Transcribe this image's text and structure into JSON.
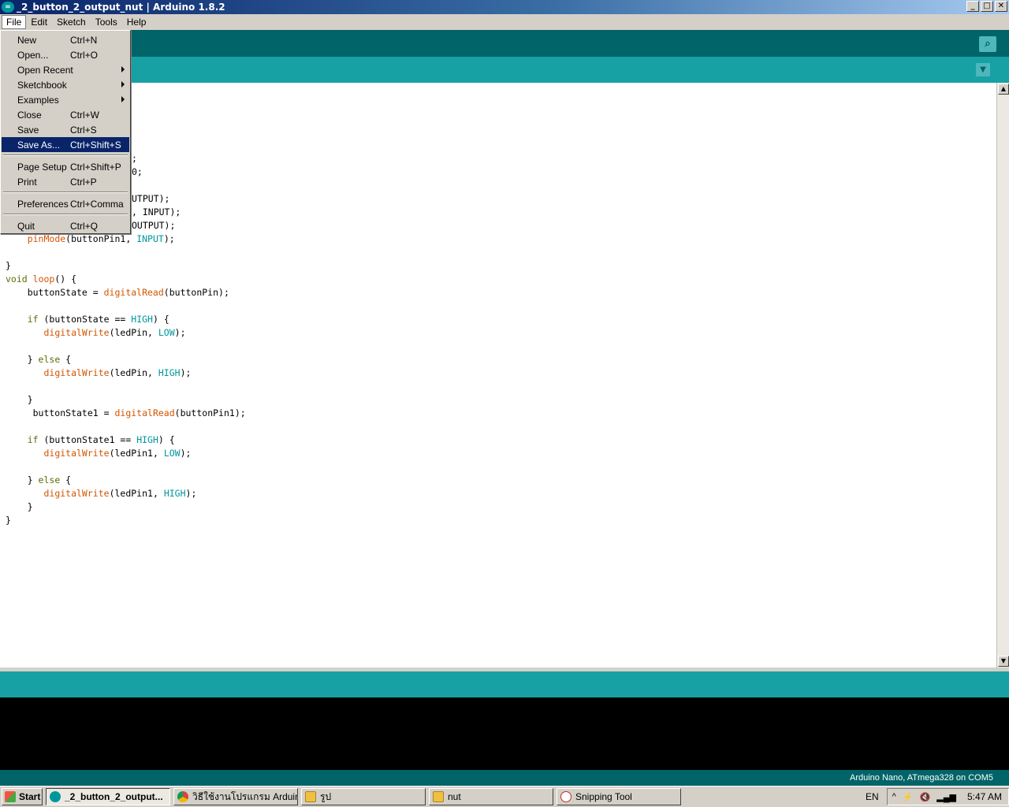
{
  "window": {
    "title": "_2_button_2_output_nut | Arduino 1.8.2",
    "controls": {
      "minimize": "_",
      "maximize": "□",
      "close": "✕"
    }
  },
  "menubar": {
    "items": [
      "File",
      "Edit",
      "Sketch",
      "Tools",
      "Help"
    ]
  },
  "file_menu": {
    "items": [
      {
        "label": "New",
        "shortcut": "Ctrl+N"
      },
      {
        "label": "Open...",
        "shortcut": "Ctrl+O"
      },
      {
        "label": "Open Recent",
        "shortcut": ""
      },
      {
        "label": "Sketchbook",
        "shortcut": ""
      },
      {
        "label": "Examples",
        "shortcut": ""
      },
      {
        "label": "Close",
        "shortcut": "Ctrl+W"
      },
      {
        "label": "Save",
        "shortcut": "Ctrl+S"
      },
      {
        "label": "Save As...",
        "shortcut": "Ctrl+Shift+S"
      },
      {
        "label": "Page Setup",
        "shortcut": "Ctrl+Shift+P"
      },
      {
        "label": "Print",
        "shortcut": "Ctrl+P"
      },
      {
        "label": "Preferences",
        "shortcut": "Ctrl+Comma"
      },
      {
        "label": "Quit",
        "shortcut": "Ctrl+Q"
      }
    ],
    "selected": "Save As..."
  },
  "editor": {
    "visible_fragments": [
      ";",
      "0;",
      "UTPUT);",
      ", INPUT);",
      "OUTPUT);"
    ],
    "lines": [
      "    pinMode(buttonPin1, INPUT);",
      "",
      "}",
      "void loop() {",
      "    buttonState = digitalRead(buttonPin);",
      "",
      "    if (buttonState == HIGH) {",
      "       digitalWrite(ledPin, LOW);",
      "",
      "    } else {",
      "       digitalWrite(ledPin, HIGH);",
      "",
      "    }",
      "     buttonState1 = digitalRead(buttonPin1);",
      "",
      "    if (buttonState1 == HIGH) {",
      "       digitalWrite(ledPin1, LOW);",
      "",
      "    } else {",
      "       digitalWrite(ledPin1, HIGH);",
      "    }",
      "}"
    ]
  },
  "footer": {
    "board": "Arduino Nano, ATmega328 on COM5"
  },
  "taskbar": {
    "start": "Start",
    "tasks": [
      {
        "label": "_2_button_2_output...",
        "icon": "arduino-icon",
        "active": true
      },
      {
        "label": "วิธีใช้งานโปรแกรม Arduin...",
        "icon": "chrome-icon",
        "active": false
      },
      {
        "label": "รูป",
        "icon": "folder-icon",
        "active": false
      },
      {
        "label": "nut",
        "icon": "folder-icon",
        "active": false
      },
      {
        "label": "Snipping Tool",
        "icon": "snipping-tool-icon",
        "active": false
      }
    ],
    "language": "EN",
    "clock": "5:47 AM"
  },
  "colors": {
    "toolbar": "#006468",
    "tabbar": "#17a1a5",
    "keyword": "#5e6d03",
    "function": "#d35400",
    "constant": "#00979c",
    "menu_highlight": "#0a246a"
  }
}
